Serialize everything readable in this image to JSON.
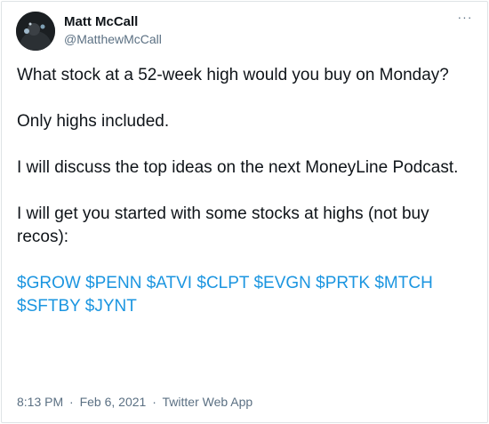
{
  "author": {
    "name": "Matt McCall",
    "handle": "@MatthewMcCall"
  },
  "menu": {
    "more_label": "···"
  },
  "tweet": {
    "paragraphs": [
      "What stock at a 52-week high would you buy on Monday?",
      "Only highs included.",
      "I will discuss the top ideas on the next MoneyLine Podcast.",
      "I will get you started with some stocks at highs (not buy recos):"
    ],
    "cashtags": [
      "$GROW",
      "$PENN",
      "$ATVI",
      "$CLPT",
      "$EVGN",
      "$PRTK",
      "$MTCH",
      "$SFTBY",
      "$JYNT"
    ]
  },
  "meta": {
    "time": "8:13 PM",
    "separator": "·",
    "date": "Feb 6, 2021",
    "source": "Twitter Web App"
  },
  "colors": {
    "text": "#0f1419",
    "secondary": "#5b7083",
    "link": "#1b95e0"
  },
  "icons": {
    "more": "more-horizontal-icon",
    "avatar": "avatar"
  }
}
